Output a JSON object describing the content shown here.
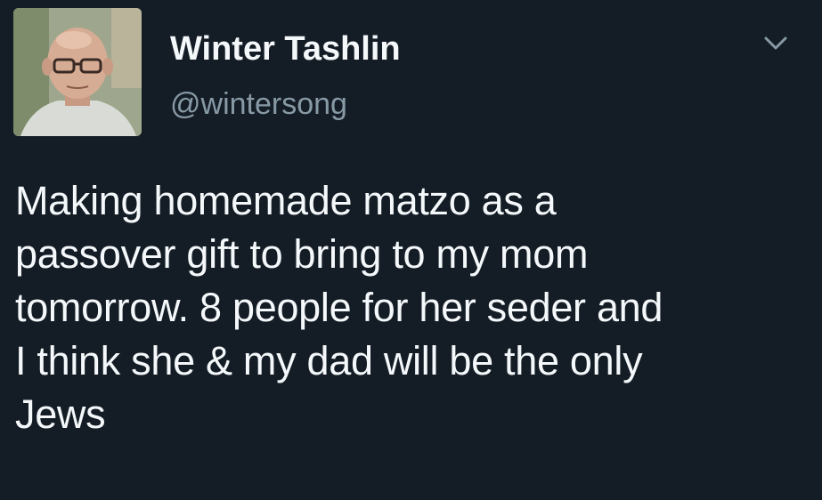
{
  "tweet": {
    "display_name": "Winter Tashlin",
    "handle": "@wintersong",
    "text": "Making homemade matzo as a\npassover gift to bring to my mom\ntomorrow. 8 people for her seder and\nI think she & my dad will be the only\nJews"
  },
  "icons": {
    "avatar": "profile-photo",
    "menu": "chevron-down-icon"
  },
  "colors": {
    "background": "#141d26",
    "text": "#f5f8fa",
    "secondary_text": "#8899a6"
  }
}
